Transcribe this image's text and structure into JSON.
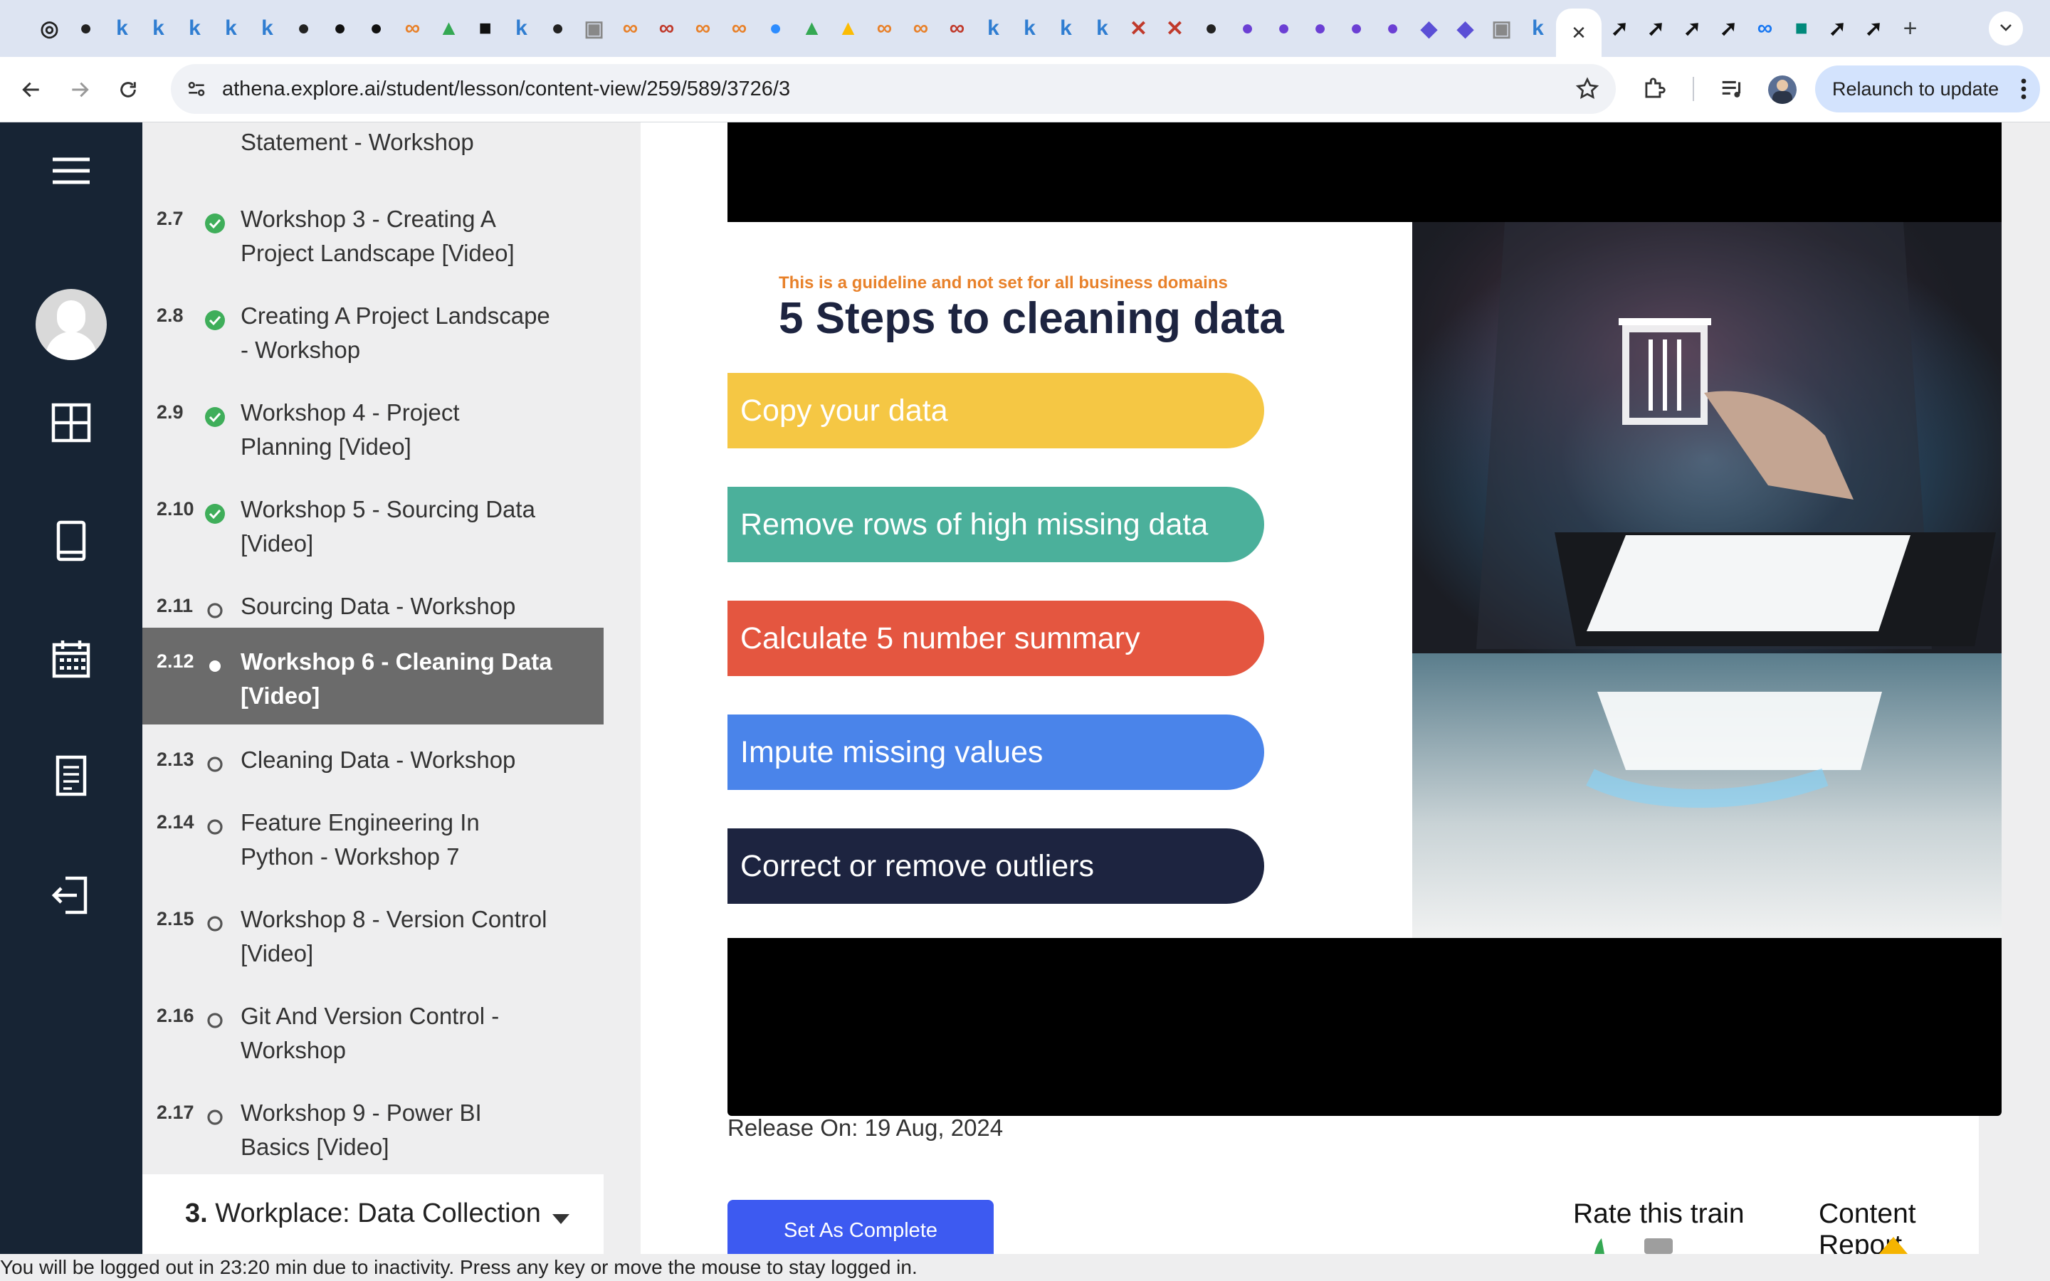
{
  "browser": {
    "url": "athena.explore.ai/student/lesson/content-view/259/589/3726/3",
    "relaunch_label": "Relaunch to update",
    "new_tab": "+",
    "close_tab": "✕"
  },
  "tabs": [
    {
      "icon": "openai-icon",
      "glyph": "◎",
      "color": "#222"
    },
    {
      "icon": "github-icon",
      "glyph": "●",
      "color": "#222"
    },
    {
      "icon": "k-icon",
      "glyph": "k",
      "color": "#2f7dd1"
    },
    {
      "icon": "k-icon",
      "glyph": "k",
      "color": "#2f7dd1"
    },
    {
      "icon": "k-icon",
      "glyph": "k",
      "color": "#2f7dd1"
    },
    {
      "icon": "k-icon",
      "glyph": "k",
      "color": "#2f7dd1"
    },
    {
      "icon": "k-icon",
      "glyph": "k",
      "color": "#2f7dd1"
    },
    {
      "icon": "github-icon",
      "glyph": "●",
      "color": "#222"
    },
    {
      "icon": "kaggle-icon",
      "glyph": "●",
      "color": "#111"
    },
    {
      "icon": "kaggle-icon",
      "glyph": "●",
      "color": "#111"
    },
    {
      "icon": "loop-icon",
      "glyph": "∞",
      "color": "#e8812a"
    },
    {
      "icon": "drive-icon",
      "glyph": "▲",
      "color": "#34a853"
    },
    {
      "icon": "ti-icon",
      "glyph": "■",
      "color": "#111"
    },
    {
      "icon": "k-icon",
      "glyph": "k",
      "color": "#2f7dd1"
    },
    {
      "icon": "github-icon",
      "glyph": "●",
      "color": "#222"
    },
    {
      "icon": "doc-icon",
      "glyph": "▣",
      "color": "#888"
    },
    {
      "icon": "loop-icon",
      "glyph": "∞",
      "color": "#e8812a"
    },
    {
      "icon": "loop-icon",
      "glyph": "∞",
      "color": "#c0392b"
    },
    {
      "icon": "loop-icon",
      "glyph": "∞",
      "color": "#e8812a"
    },
    {
      "icon": "loop-icon",
      "glyph": "∞",
      "color": "#e8812a"
    },
    {
      "icon": "zoom-icon",
      "glyph": "●",
      "color": "#2d8cff"
    },
    {
      "icon": "drive-icon",
      "glyph": "▲",
      "color": "#34a853"
    },
    {
      "icon": "drive-icon",
      "glyph": "▲",
      "color": "#fbbc04"
    },
    {
      "icon": "loop-icon",
      "glyph": "∞",
      "color": "#e8812a"
    },
    {
      "icon": "loop-icon",
      "glyph": "∞",
      "color": "#e8812a"
    },
    {
      "icon": "loop-icon",
      "glyph": "∞",
      "color": "#c0392b"
    },
    {
      "icon": "k-icon",
      "glyph": "k",
      "color": "#2f7dd1"
    },
    {
      "icon": "k-icon",
      "glyph": "k",
      "color": "#2f7dd1"
    },
    {
      "icon": "k-icon",
      "glyph": "k",
      "color": "#2f7dd1"
    },
    {
      "icon": "k-icon",
      "glyph": "k",
      "color": "#2f7dd1"
    },
    {
      "icon": "x-icon",
      "glyph": "✕",
      "color": "#c0392b"
    },
    {
      "icon": "x-icon",
      "glyph": "✕",
      "color": "#c0392b"
    },
    {
      "icon": "github-icon",
      "glyph": "●",
      "color": "#222"
    },
    {
      "icon": "purple-icon",
      "glyph": "●",
      "color": "#6b3fd4"
    },
    {
      "icon": "purple-icon",
      "glyph": "●",
      "color": "#6b3fd4"
    },
    {
      "icon": "purple-icon",
      "glyph": "●",
      "color": "#6b3fd4"
    },
    {
      "icon": "purple-icon",
      "glyph": "●",
      "color": "#6b3fd4"
    },
    {
      "icon": "purple-icon",
      "glyph": "●",
      "color": "#6b3fd4"
    },
    {
      "icon": "layers-icon",
      "glyph": "◆",
      "color": "#5b4fd6"
    },
    {
      "icon": "layers-icon",
      "glyph": "◆",
      "color": "#5b4fd6"
    },
    {
      "icon": "doc-icon",
      "glyph": "▣",
      "color": "#888"
    },
    {
      "icon": "k-icon",
      "glyph": "k",
      "color": "#2f7dd1"
    }
  ],
  "tabs_after": [
    {
      "icon": "arrow-icon",
      "glyph": "➚",
      "color": "#111"
    },
    {
      "icon": "arrow-icon",
      "glyph": "➚",
      "color": "#111"
    },
    {
      "icon": "arrow-icon",
      "glyph": "➚",
      "color": "#111"
    },
    {
      "icon": "arrow-icon",
      "glyph": "➚",
      "color": "#111"
    },
    {
      "icon": "meta-icon",
      "glyph": "∞",
      "color": "#1877f2"
    },
    {
      "icon": "meet-icon",
      "glyph": "■",
      "color": "#00897b"
    },
    {
      "icon": "arrow-icon",
      "glyph": "➚",
      "color": "#111"
    },
    {
      "icon": "arrow-icon",
      "glyph": "➚",
      "color": "#111"
    }
  ],
  "lessons": [
    {
      "num": "",
      "title": "Statement - Workshop",
      "status": "none",
      "active": false
    },
    {
      "num": "2.7",
      "title": "Workshop 3 - Creating A Project Landscape [Video]",
      "status": "done",
      "active": false
    },
    {
      "num": "2.8",
      "title": "Creating A Project Landscape - Workshop",
      "status": "done",
      "active": false
    },
    {
      "num": "2.9",
      "title": "Workshop 4 - Project Planning [Video]",
      "status": "done",
      "active": false
    },
    {
      "num": "2.10",
      "title": "Workshop 5 - Sourcing Data [Video]",
      "status": "done",
      "active": false
    },
    {
      "num": "2.11",
      "title": "Sourcing Data - Workshop",
      "status": "open",
      "active": false
    },
    {
      "num": "2.12",
      "title": "Workshop 6 - Cleaning Data [Video]",
      "status": "current",
      "active": true
    },
    {
      "num": "2.13",
      "title": "Cleaning Data - Workshop",
      "status": "open",
      "active": false
    },
    {
      "num": "2.14",
      "title": "Feature Engineering In Python - Workshop 7",
      "status": "open",
      "active": false
    },
    {
      "num": "2.15",
      "title": "Workshop 8 - Version Control [Video]",
      "status": "open",
      "active": false
    },
    {
      "num": "2.16",
      "title": "Git And Version Control - Workshop",
      "status": "open",
      "active": false
    },
    {
      "num": "2.17",
      "title": "Workshop 9 - Power BI Basics [Video]",
      "status": "open",
      "active": false
    }
  ],
  "section3": {
    "number": "3.",
    "label": "Workplace: Data Collection"
  },
  "slide": {
    "note": "This is a guideline and not set for all business domains",
    "heading": "5 Steps to cleaning data",
    "steps": [
      {
        "label": "Copy your data",
        "color": "#f5c744"
      },
      {
        "label": "Remove rows of high missing data",
        "color": "#4bb09b"
      },
      {
        "label": "Calculate 5 number summary",
        "color": "#e45640"
      },
      {
        "label": "Impute missing values",
        "color": "#4a84ea"
      },
      {
        "label": "Correct or remove outliers",
        "color": "#1d2440"
      }
    ]
  },
  "release": "Release On: 19 Aug, 2024",
  "complete_button": "Set As Complete",
  "rate_label": "Rate this train",
  "report_label": "Content Report",
  "timeout_message": "You will be logged out in 23:20 min due to inactivity. Press any key or move the mouse to stay logged in."
}
